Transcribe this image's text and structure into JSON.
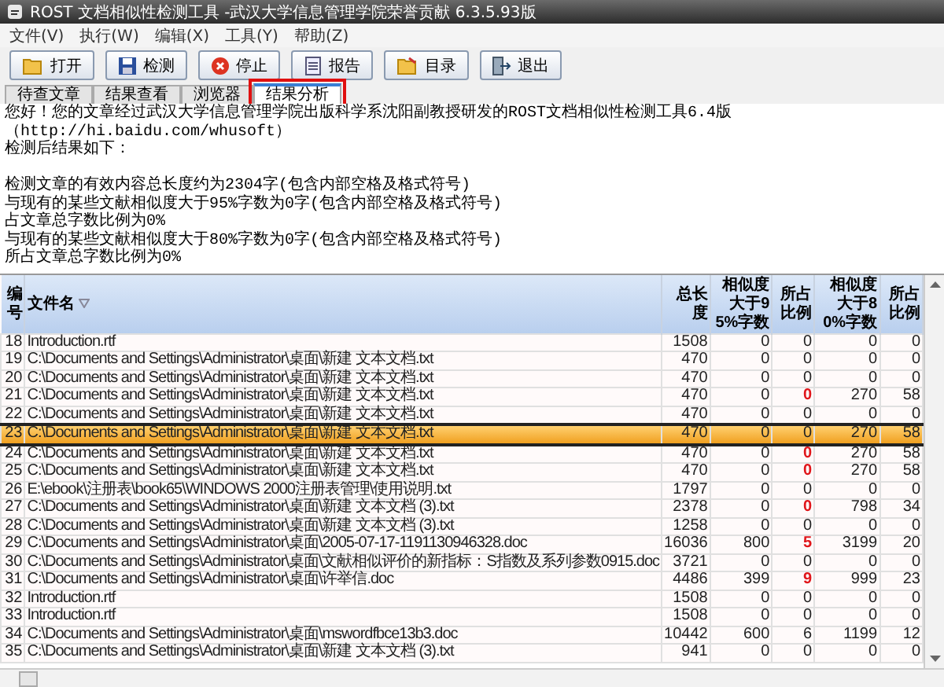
{
  "window": {
    "title": "ROST 文档相似性检测工具 -武汉大学信息管理学院荣誉贡献 6.3.5.93版"
  },
  "menu": [
    "文件(V)",
    "执行(W)",
    "编辑(X)",
    "工具(Y)",
    "帮助(Z)"
  ],
  "toolbar": [
    "打开",
    "检测",
    "停止",
    "报告",
    "目录",
    "退出"
  ],
  "tabs": [
    {
      "label": "待查文章",
      "selected": false,
      "annotated": false
    },
    {
      "label": "结果查看",
      "selected": false,
      "annotated": false
    },
    {
      "label": "浏览器",
      "selected": false,
      "annotated": false
    },
    {
      "label": "结果分析",
      "selected": true,
      "annotated": true
    }
  ],
  "report": [
    "您好！您的文章经过武汉大学信息管理学院出版科学系沈阳副教授研发的ROST文档相似性检测工具6.4版（http://hi.baidu.com/whusoft）",
    "检测后结果如下：",
    "检测文章的有效内容总长度约为2304字(包含内部空格及格式符号)",
    "与现有的某些文献相似度大于95%字数为0字(包含内部空格及格式符号)",
    "占文章总字数比例为0%",
    "与现有的某些文献相似度大于80%字数为0字(包含内部空格及格式符号)",
    "所占文章总字数比例为0%"
  ],
  "table": {
    "columns": [
      "编号",
      "文件名",
      "总长度",
      "相似度大于95%字数",
      "所占比例",
      "相似度大于80%字数",
      "所占比例"
    ],
    "rows": [
      {
        "no": "18",
        "file": "Introduction.rtf",
        "total": "1508",
        "c95": "0",
        "r95": "0",
        "c80": "0",
        "r80": "0",
        "flag": false,
        "selected": false
      },
      {
        "no": "19",
        "file": "C:\\Documents and Settings\\Administrator\\桌面\\新建 文本文档.txt",
        "total": "470",
        "c95": "0",
        "r95": "0",
        "c80": "0",
        "r80": "0",
        "flag": false,
        "selected": false
      },
      {
        "no": "20",
        "file": "C:\\Documents and Settings\\Administrator\\桌面\\新建 文本文档.txt",
        "total": "470",
        "c95": "0",
        "r95": "0",
        "c80": "0",
        "r80": "0",
        "flag": false,
        "selected": false
      },
      {
        "no": "21",
        "file": "C:\\Documents and Settings\\Administrator\\桌面\\新建 文本文档.txt",
        "total": "470",
        "c95": "0",
        "r95": "0",
        "c80": "270",
        "r80": "58",
        "flag": true,
        "selected": false
      },
      {
        "no": "22",
        "file": "C:\\Documents and Settings\\Administrator\\桌面\\新建 文本文档.txt",
        "total": "470",
        "c95": "0",
        "r95": "0",
        "c80": "0",
        "r80": "0",
        "flag": false,
        "selected": false
      },
      {
        "no": "23",
        "file": "C:\\Documents and Settings\\Administrator\\桌面\\新建 文本文档.txt",
        "total": "470",
        "c95": "0",
        "r95": "0",
        "c80": "270",
        "r80": "58",
        "flag": false,
        "selected": true
      },
      {
        "no": "24",
        "file": "C:\\Documents and Settings\\Administrator\\桌面\\新建 文本文档.txt",
        "total": "470",
        "c95": "0",
        "r95": "0",
        "c80": "270",
        "r80": "58",
        "flag": true,
        "selected": false
      },
      {
        "no": "25",
        "file": "C:\\Documents and Settings\\Administrator\\桌面\\新建 文本文档.txt",
        "total": "470",
        "c95": "0",
        "r95": "0",
        "c80": "270",
        "r80": "58",
        "flag": true,
        "selected": false
      },
      {
        "no": "26",
        "file": "E:\\ebook\\注册表\\book65\\WINDOWS 2000注册表管理\\使用说明.txt",
        "total": "1797",
        "c95": "0",
        "r95": "0",
        "c80": "0",
        "r80": "0",
        "flag": false,
        "selected": false
      },
      {
        "no": "27",
        "file": "C:\\Documents and Settings\\Administrator\\桌面\\新建 文本文档 (3).txt",
        "total": "2378",
        "c95": "0",
        "r95": "0",
        "c80": "798",
        "r80": "34",
        "flag": true,
        "selected": false
      },
      {
        "no": "28",
        "file": "C:\\Documents and Settings\\Administrator\\桌面\\新建 文本文档 (3).txt",
        "total": "1258",
        "c95": "0",
        "r95": "0",
        "c80": "0",
        "r80": "0",
        "flag": false,
        "selected": false
      },
      {
        "no": "29",
        "file": "C:\\Documents and Settings\\Administrator\\桌面\\2005-07-17-1191130946328.doc",
        "total": "16036",
        "c95": "800",
        "r95": "5",
        "c80": "3199",
        "r80": "20",
        "flag": true,
        "selected": false
      },
      {
        "no": "30",
        "file": "C:\\Documents and Settings\\Administrator\\桌面\\文献相似评价的新指标：S指数及系列参数0915.doc",
        "total": "3721",
        "c95": "0",
        "r95": "0",
        "c80": "0",
        "r80": "0",
        "flag": false,
        "selected": false
      },
      {
        "no": "31",
        "file": "C:\\Documents and Settings\\Administrator\\桌面\\许举信.doc",
        "total": "4486",
        "c95": "399",
        "r95": "9",
        "c80": "999",
        "r80": "23",
        "flag": true,
        "selected": false
      },
      {
        "no": "32",
        "file": "Introduction.rtf",
        "total": "1508",
        "c95": "0",
        "r95": "0",
        "c80": "0",
        "r80": "0",
        "flag": false,
        "selected": false
      },
      {
        "no": "33",
        "file": "Introduction.rtf",
        "total": "1508",
        "c95": "0",
        "r95": "0",
        "c80": "0",
        "r80": "0",
        "flag": false,
        "selected": false
      },
      {
        "no": "34",
        "file": "C:\\Documents and Settings\\Administrator\\桌面\\mswordfbce13b3.doc",
        "total": "10442",
        "c95": "600",
        "r95": "6",
        "c80": "1199",
        "r80": "12",
        "flag": false,
        "selected": false
      },
      {
        "no": "35",
        "file": "C:\\Documents and Settings\\Administrator\\桌面\\新建 文本文档 (3).txt",
        "total": "941",
        "c95": "0",
        "r95": "0",
        "c80": "0",
        "r80": "0",
        "flag": false,
        "selected": false
      }
    ]
  }
}
